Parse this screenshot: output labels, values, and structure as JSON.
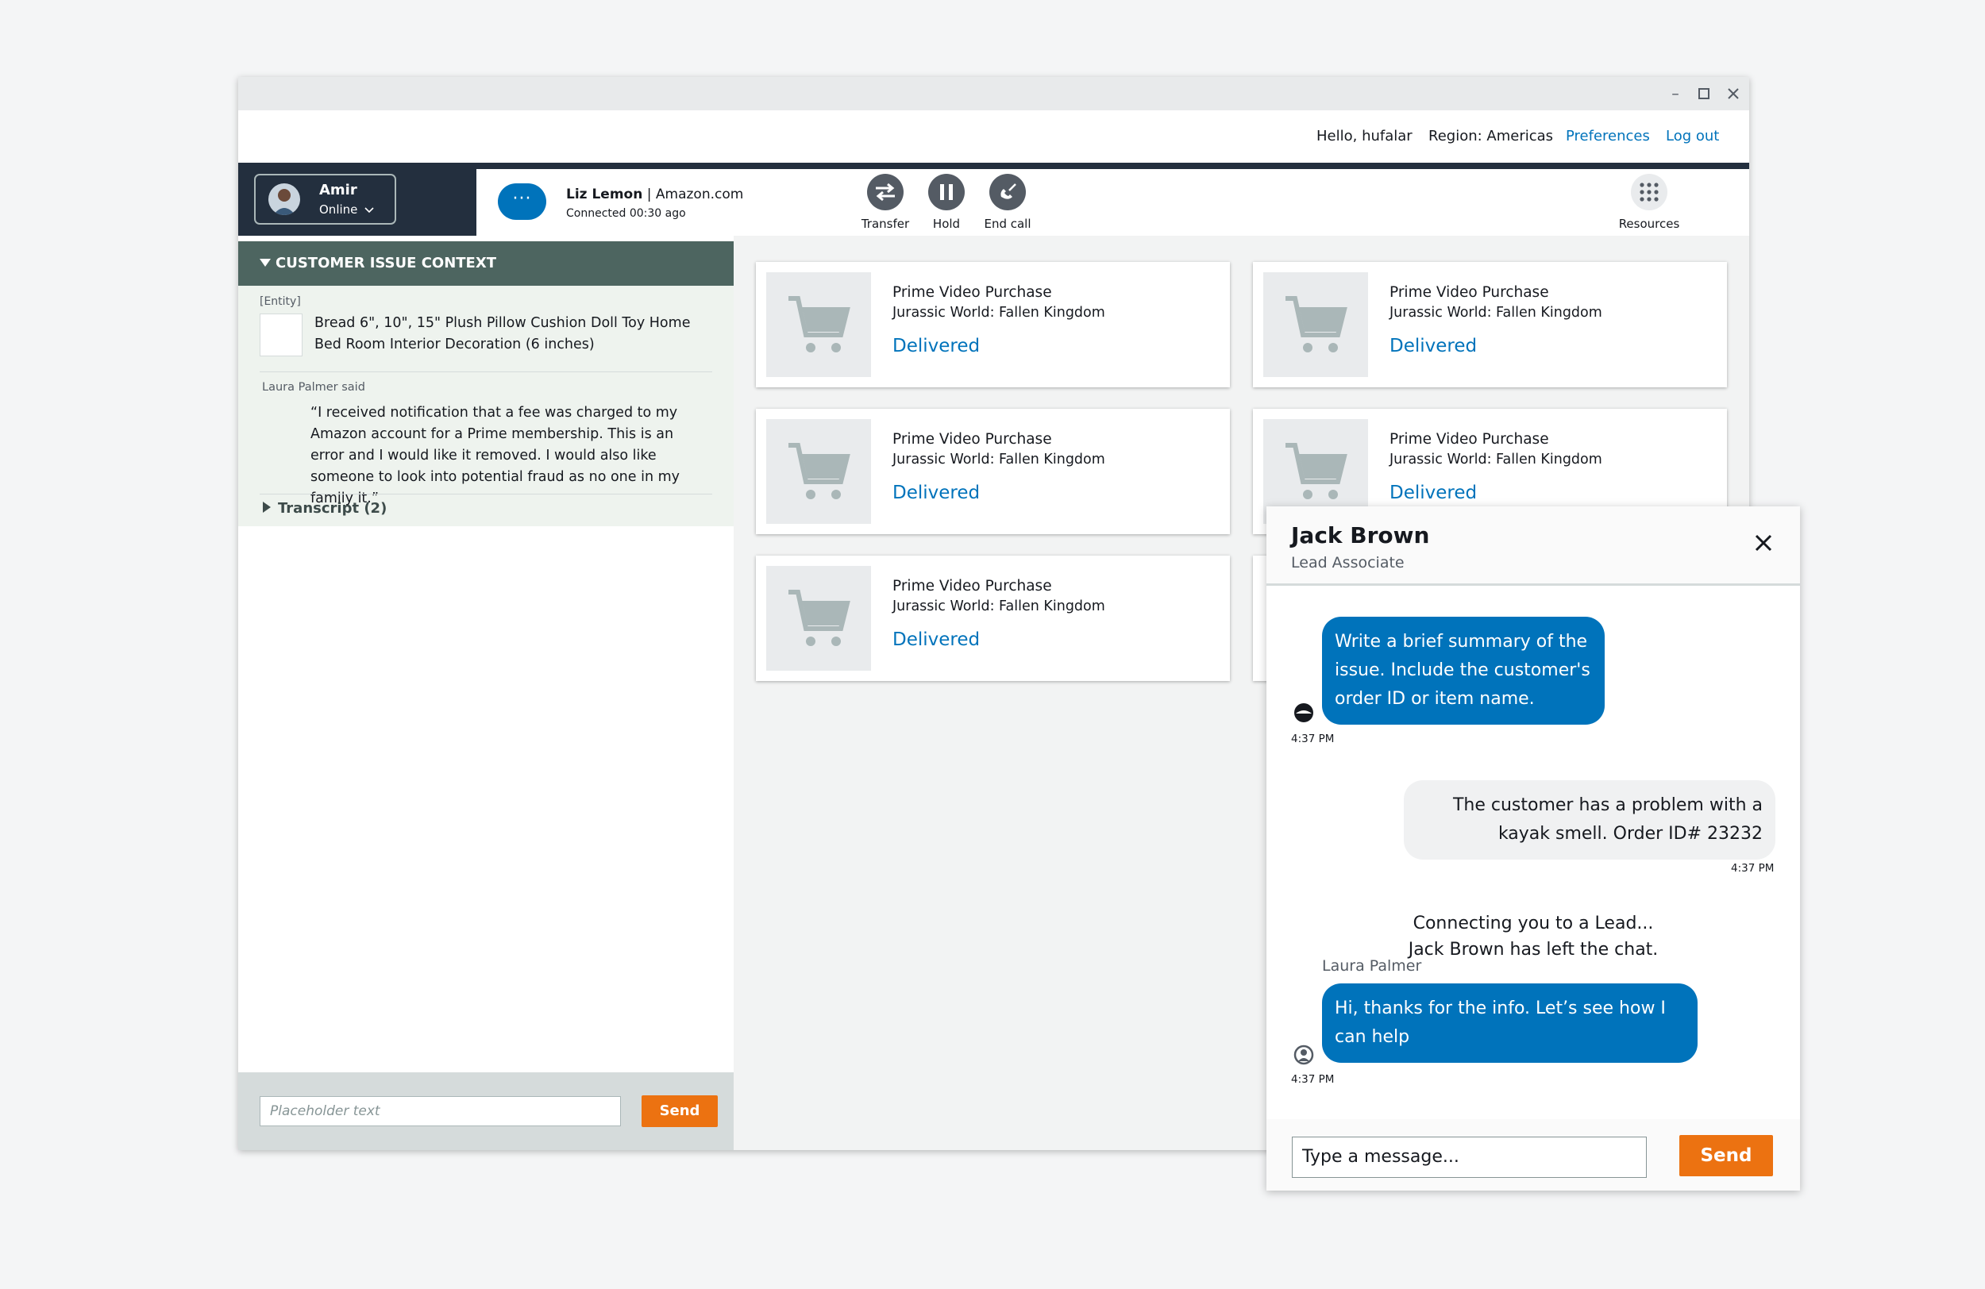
{
  "header": {
    "greeting": "Hello, hufalar",
    "region": "Region: Americas",
    "preferences_link": "Preferences",
    "logout_link": "Log out"
  },
  "agent": {
    "name": "Amir",
    "status": "Online"
  },
  "contact": {
    "name": "Liz Lemon",
    "source": "| Amazon.com",
    "connected": "Connected 00:30 ago",
    "chat_icon": "···"
  },
  "call_controls": {
    "transfer": "Transfer",
    "hold": "Hold",
    "end_call": "End call",
    "resources": "Resources"
  },
  "context": {
    "title": "CUSTOMER ISSUE CONTEXT",
    "entity_tag": "[Entity]",
    "entity_text": "Bread 6\", 10\", 15\" Plush Pillow Cushion Doll Toy Home Bed Room Interior Decoration (6 inches)",
    "said_label": "Laura Palmer said",
    "quote": "“I received notification that a fee was charged to my Amazon account for a Prime membership. This is an error and I would like it removed. I would also like someone to look into potential fraud as no one in my family it.”",
    "transcript": "Transcript (2)",
    "input_placeholder": "Placeholder text",
    "send_label": "Send"
  },
  "orders": [
    {
      "title": "Prime Video Purchase",
      "subtitle": "Jurassic World: Fallen Kingdom",
      "status": "Delivered"
    },
    {
      "title": "Prime Video Purchase",
      "subtitle": "Jurassic World: Fallen Kingdom",
      "status": "Delivered"
    },
    {
      "title": "Prime Video Purchase",
      "subtitle": "Jurassic World: Fallen Kingdom",
      "status": "Delivered"
    },
    {
      "title": "Prime Video Purchase",
      "subtitle": "Jurassic World: Fallen Kingdom",
      "status": "Delivered"
    },
    {
      "title": "Prime Video Purchase",
      "subtitle": "Jurassic World: Fallen Kingdom",
      "status": "Delivered"
    }
  ],
  "chat": {
    "title": "Jack Brown",
    "role": "Lead Associate",
    "messages": [
      {
        "text": "Write a brief summary of the issue. Include the customer's order ID or item name.",
        "time": "4:37 PM"
      },
      {
        "text": "The customer has a problem with a kayak smell.  Order ID# 23232",
        "time": "4:37 PM"
      },
      {
        "text": "Connecting you to a Lead...",
        "time": ""
      },
      {
        "text": "Jack Brown has left the chat.",
        "time": ""
      },
      {
        "text": "Hi, thanks for the info. Let’s see how I can help",
        "time": "4:37 PM"
      }
    ],
    "sender_label": "Laura Palmer",
    "input_placeholder": "Type a message...",
    "send_label": "Send"
  },
  "colors": {
    "accent_blue": "#0073bb",
    "send_orange": "#ec7211",
    "nav_dark": "#232f3e",
    "context_header": "#4d6560"
  },
  "icons": [
    "minimize-icon",
    "maximize-icon",
    "close-icon",
    "chevron-down-icon",
    "chat-bubble-icon",
    "transfer-icon",
    "pause-icon",
    "end-call-icon",
    "grid-icon",
    "caret-down-icon",
    "caret-right-icon",
    "cart-icon"
  ]
}
